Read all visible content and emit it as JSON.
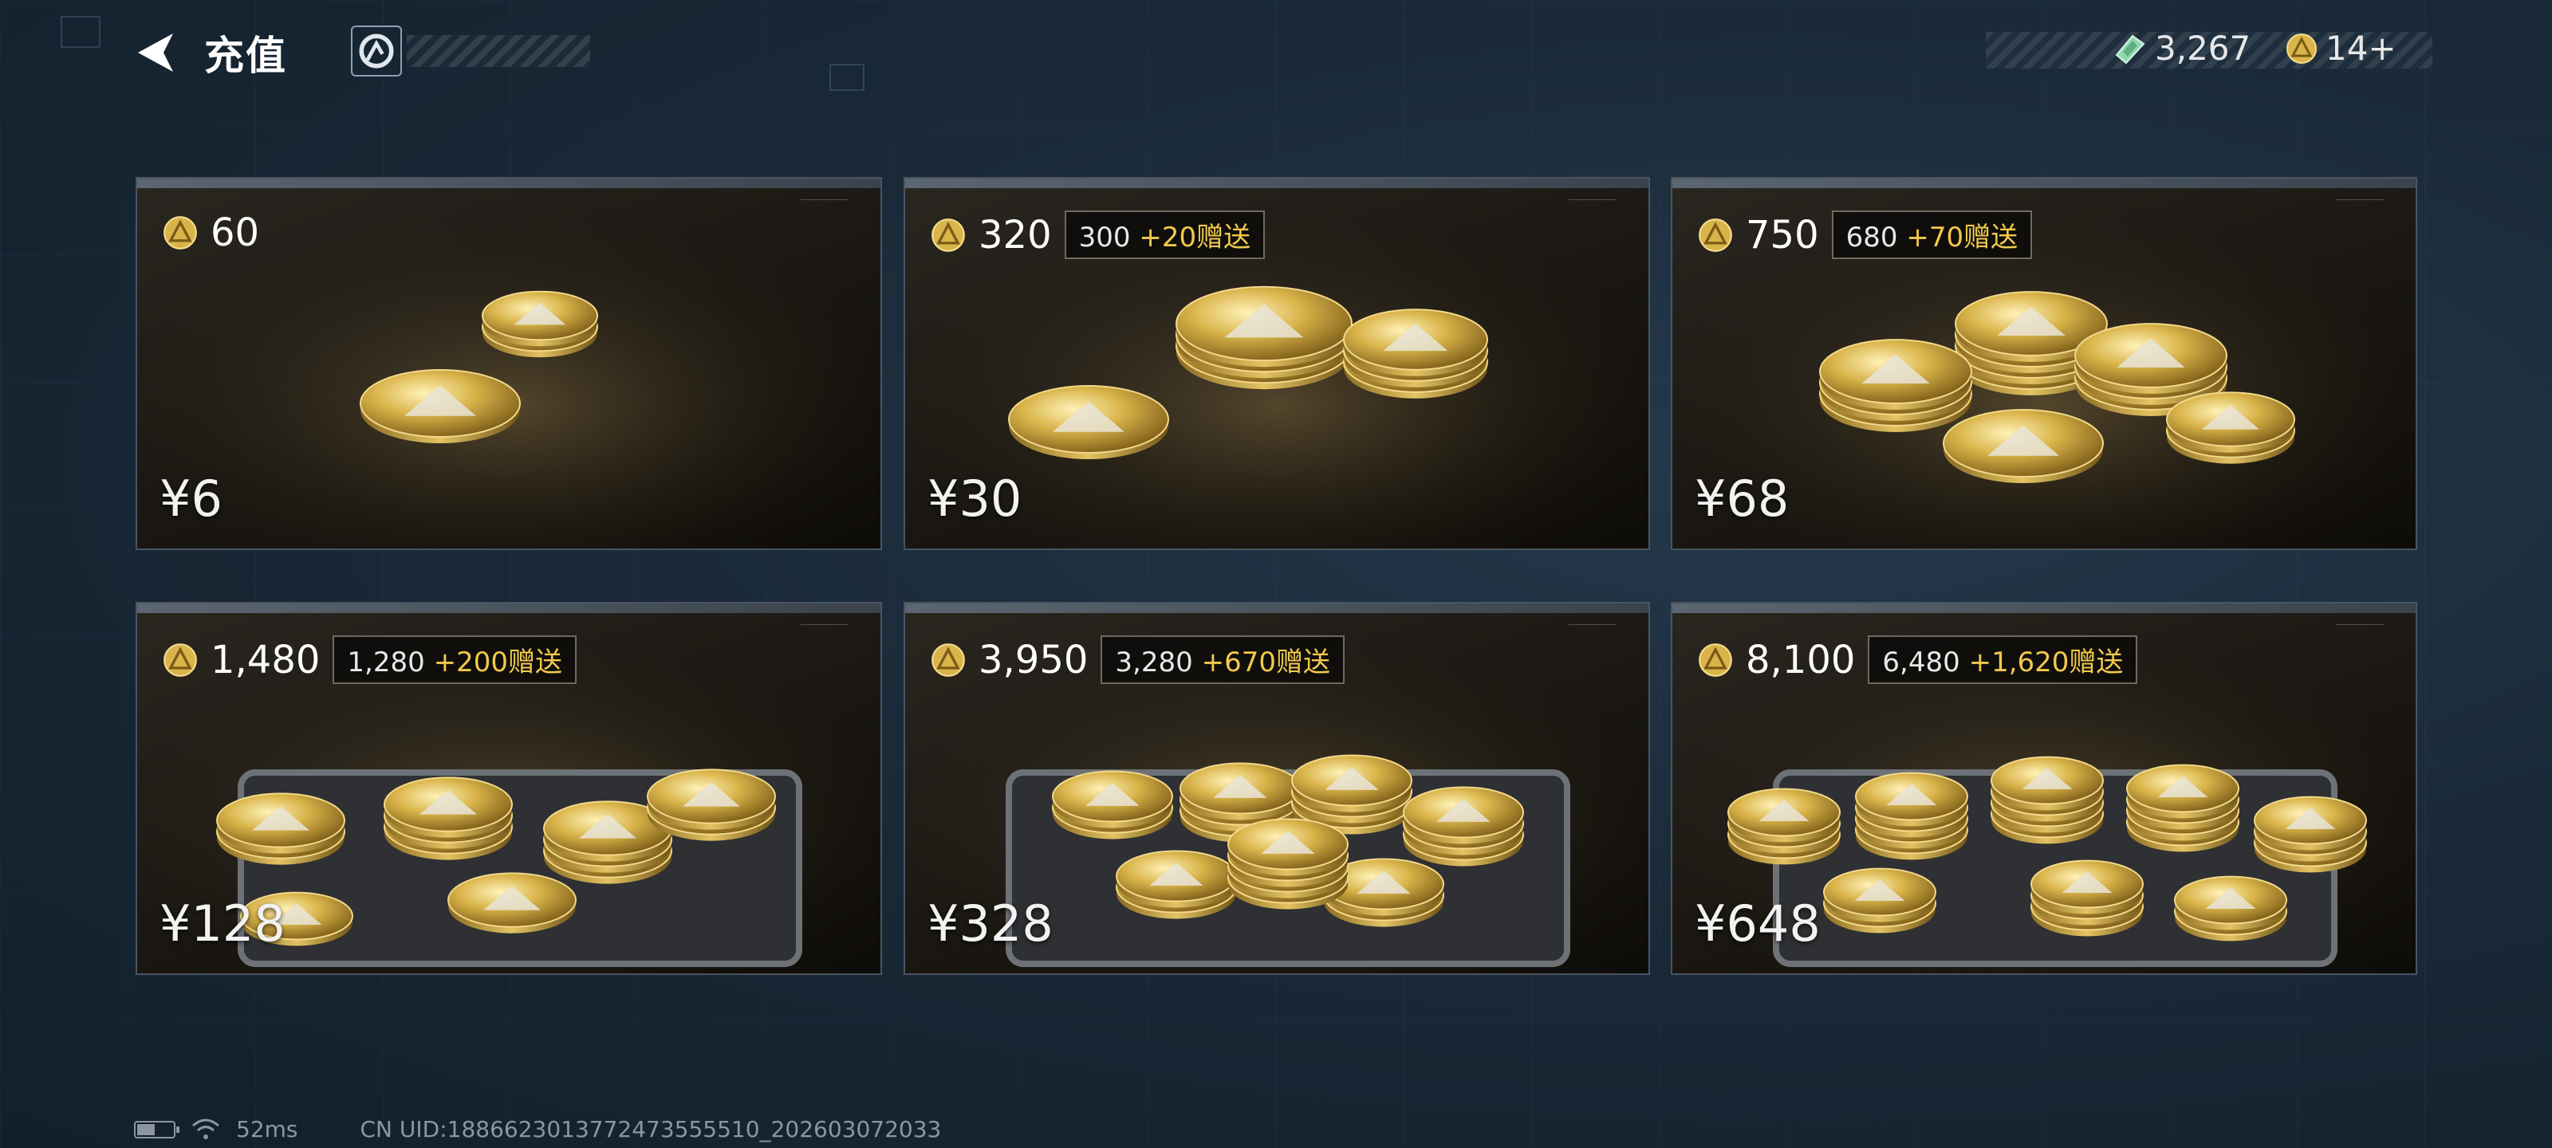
{
  "header": {
    "title": "充值"
  },
  "currencies": [
    {
      "name": "gem",
      "icon": "gem-icon",
      "value": "3,267"
    },
    {
      "name": "coin",
      "icon": "coin-icon",
      "value": "14+"
    }
  ],
  "packs": [
    {
      "amount": "60",
      "base": "",
      "bonus": "",
      "price": "¥6"
    },
    {
      "amount": "320",
      "base": "300",
      "bonus": "+20赠送",
      "price": "¥30"
    },
    {
      "amount": "750",
      "base": "680",
      "bonus": "+70赠送",
      "price": "¥68"
    },
    {
      "amount": "1,480",
      "base": "1,280",
      "bonus": "+200赠送",
      "price": "¥128"
    },
    {
      "amount": "3,950",
      "base": "3,280",
      "bonus": "+670赠送",
      "price": "¥328"
    },
    {
      "amount": "8,100",
      "base": "6,480",
      "bonus": "+1,620赠送",
      "price": "¥648"
    }
  ],
  "status": {
    "battery_level": 0.5,
    "latency": "52ms",
    "uid": "CN UID:1886623013772473555510_202603072033"
  },
  "colors": {
    "bonus_accent": "#f2c94c",
    "coin_gold": "#d9b44a"
  }
}
